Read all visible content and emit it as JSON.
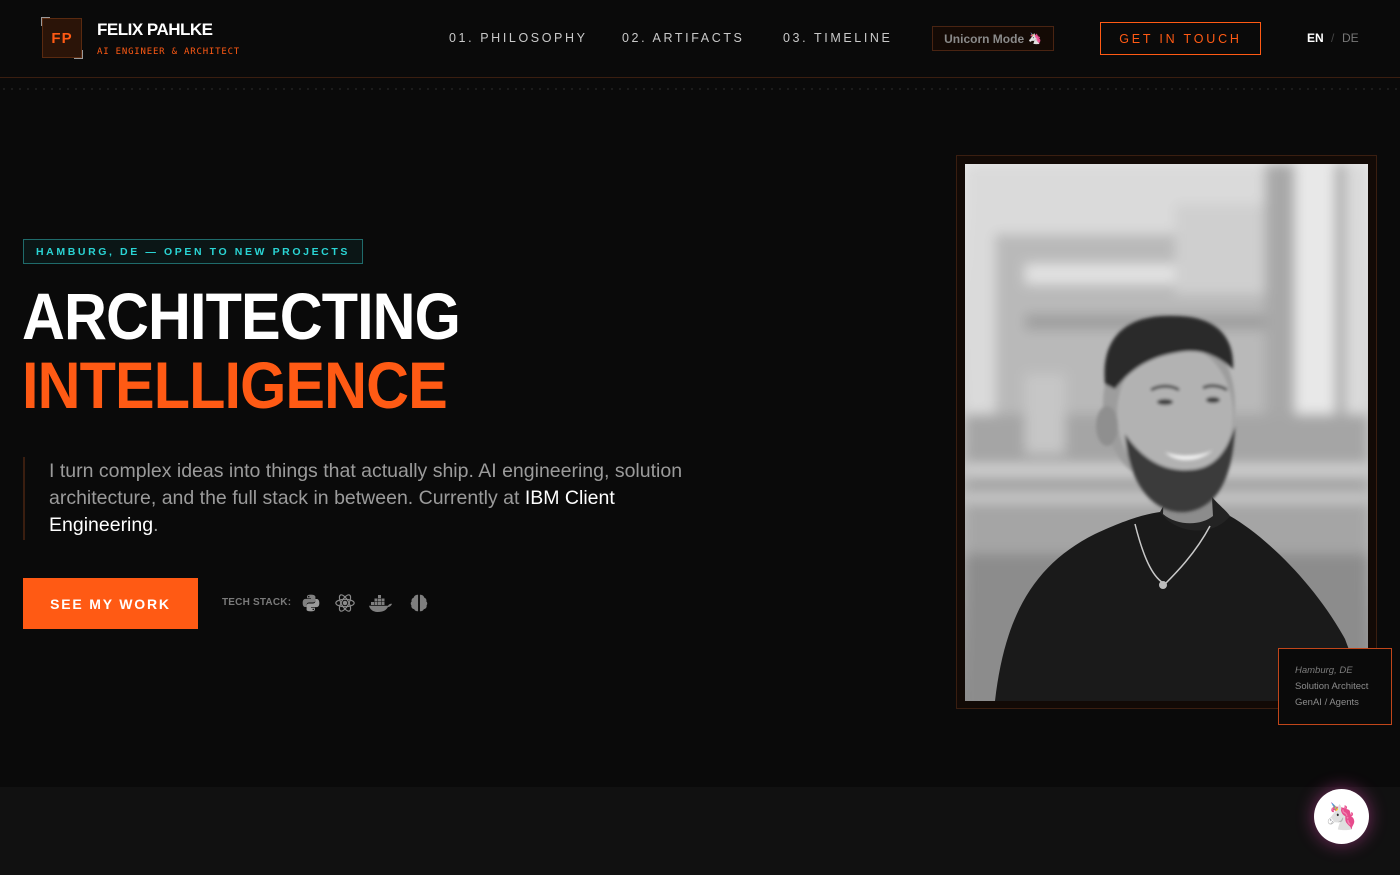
{
  "brand": {
    "logo_initials": "FP",
    "name": "FELIX PAHLKE",
    "subtitle": "AI ENGINEER & ARCHITECT"
  },
  "nav": {
    "links": [
      "01. PHILOSOPHY",
      "02. ARTIFACTS",
      "03. TIMELINE"
    ],
    "unicorn_mode": "Unicorn Mode",
    "contact": "GET IN TOUCH",
    "lang_active": "EN",
    "lang_separator": "/",
    "lang_other": "DE"
  },
  "hero": {
    "badge": "HAMBURG, DE — OPEN TO NEW PROJECTS",
    "title_line1": "ARCHITECTING",
    "title_line2": "INTELLIGENCE",
    "intro_text": "I turn complex ideas into things that actually ship. AI engineering, solution architecture, and the full stack in between. Currently at ",
    "intro_highlight": "IBM Client Engineering",
    "intro_end": ".",
    "cta": "SEE MY WORK",
    "tech_stack_label": "TECH STACK:",
    "tech_icons": [
      "python-icon",
      "react-icon",
      "docker-icon",
      "brain-icon"
    ]
  },
  "portrait": {
    "caption_location": "Hamburg, DE",
    "caption_role": "Solution Architect",
    "caption_focus": "GenAI / Agents"
  },
  "colors": {
    "accent": "#ff5a14",
    "badge_teal": "#2ad4d4",
    "background": "#0a0a0a",
    "lower_section": "#111111"
  }
}
